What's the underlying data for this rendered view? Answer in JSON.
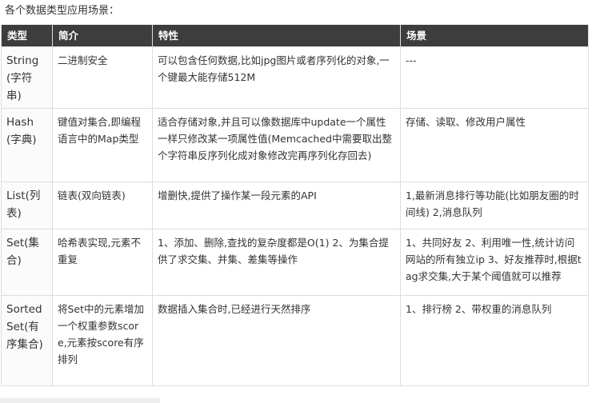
{
  "caption": "各个数据类型应用场景：",
  "table": {
    "headers": [
      "类型",
      "简介",
      "特性",
      "场景"
    ],
    "rows": [
      {
        "type": "String(字符串)",
        "intro": "二进制安全",
        "feature": "可以包含任何数据,比如jpg图片或者序列化的对象,一个键最大能存储512M",
        "scenario": "---"
      },
      {
        "type": "Hash(字典)",
        "intro": "键值对集合,即编程语言中的Map类型",
        "feature": "适合存储对象,并且可以像数据库中update一个属性一样只修改某一项属性值(Memcached中需要取出整个字符串反序列化成对象修改完再序列化存回去)",
        "scenario": "存储、读取、修改用户属性"
      },
      {
        "type": "List(列表)",
        "intro": "链表(双向链表)",
        "feature": "增删快,提供了操作某一段元素的API",
        "scenario": "1,最新消息排行等功能(比如朋友圈的时间线) 2,消息队列"
      },
      {
        "type": "Set(集合)",
        "intro": "哈希表实现,元素不重复",
        "feature": "1、添加、删除,查找的复杂度都是O(1) 2、为集合提供了求交集、并集、差集等操作",
        "scenario": "1、共同好友 2、利用唯一性,统计访问网站的所有独立ip 3、好友推荐时,根据tag求交集,大于某个阈值就可以推荐"
      },
      {
        "type": "Sorted Set(有序集合)",
        "intro": "将Set中的元素增加一个权重参数score,元素按score有序排列",
        "feature": "数据插入集合时,已经进行天然排序",
        "scenario": "1、排行榜 2、带权重的消息队列"
      }
    ]
  }
}
